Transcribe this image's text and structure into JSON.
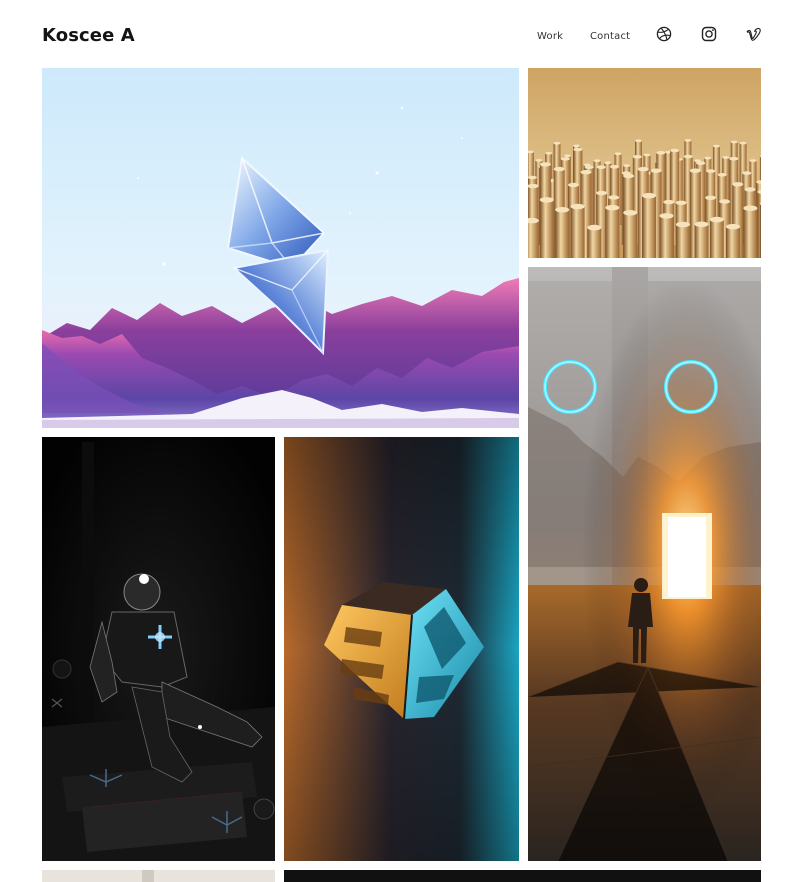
{
  "header": {
    "title": "Koscee A"
  },
  "nav": {
    "work_label": "Work",
    "contact_label": "Contact"
  },
  "social": {
    "icons": [
      "dribbble-icon",
      "instagram-icon",
      "vimeo-icon"
    ]
  },
  "gallery": {
    "items": [
      {
        "subject": "crystal-ethereum-over-mountains",
        "palette": [
          "#d4ecfa",
          "#8a3f9c",
          "#ffffff"
        ]
      },
      {
        "subject": "golden-cylinders-field",
        "palette": [
          "#d7b27a",
          "#8a5a28"
        ]
      },
      {
        "subject": "astronaut-at-glowing-portal",
        "palette": [
          "#9a8f88",
          "#ffb040",
          "#40e8ff"
        ]
      },
      {
        "subject": "astronaut-in-dark-room",
        "palette": [
          "#050505",
          "#9ad8ff"
        ]
      },
      {
        "subject": "floating-cube-orange-cyan",
        "palette": [
          "#b86a2c",
          "#22a9c4",
          "#222230"
        ]
      },
      {
        "subject": "partial-tile-light",
        "palette": [
          "#e8e4dd"
        ]
      },
      {
        "subject": "partial-tile-dark",
        "palette": [
          "#111111"
        ]
      }
    ]
  },
  "colors": {
    "background": "#ffffff",
    "title": "#141414",
    "nav_text": "#333333"
  }
}
